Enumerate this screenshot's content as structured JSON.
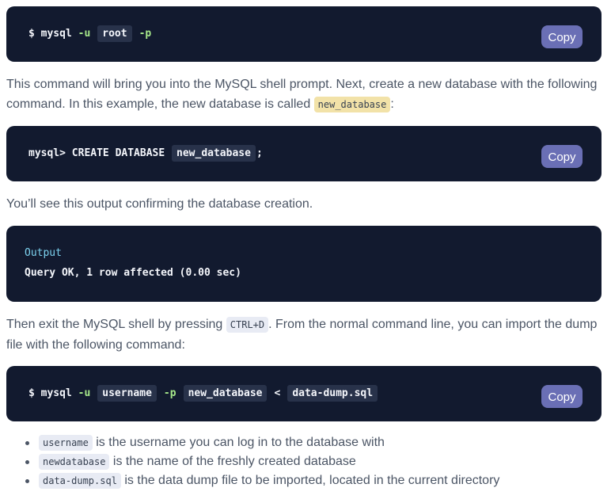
{
  "copy_label": "Copy",
  "block1": {
    "prompt": "$ mysql ",
    "flag_u": "-u",
    "user_var": "root",
    "flag_p": "-p"
  },
  "para1": {
    "text": "This command will bring you into the MySQL shell prompt. Next, create a new database with the following command. In this example, the new database is called ",
    "code": "new_database",
    "after": ":"
  },
  "block2": {
    "prefix": "mysql> CREATE DATABASE ",
    "db_var": "new_database",
    "suffix": ";"
  },
  "para2": {
    "text": "You’ll see this output confirming the database creation."
  },
  "block3": {
    "label": "Output",
    "text": "Query OK, 1 row affected (0.00 sec)"
  },
  "para3": {
    "text": "Then exit the MySQL shell by pressing ",
    "code": "CTRL+D",
    "after": ". From the normal command line, you can import the dump file with the following command:"
  },
  "block4": {
    "prompt": "$ mysql ",
    "flag_u": "-u",
    "user_var": "username",
    "flag_p": "-p",
    "db_var": "new_database",
    "redirect": "<",
    "file_var": "data-dump.sql"
  },
  "bullets": [
    {
      "code": "username",
      "text": " is the username you can log in to the database with"
    },
    {
      "code": "newdatabase",
      "text": " is the name of the freshly created database"
    },
    {
      "code": "data-dump.sql",
      "text": " is the data dump file to be imported, located in the current directory"
    }
  ]
}
